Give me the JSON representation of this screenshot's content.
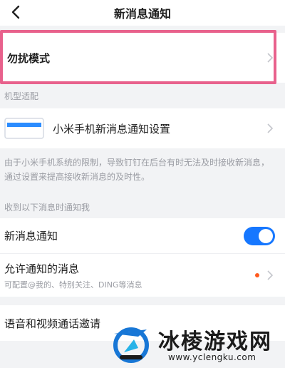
{
  "nav": {
    "title": "新消息通知",
    "back_icon": "chevron-left-icon"
  },
  "dnd": {
    "label": "勿扰模式"
  },
  "model_section": {
    "label": "机型适配"
  },
  "xiaomi": {
    "label": "小米手机新消息通知设置",
    "icon": "phone-banner-icon",
    "description": "由于小米手机系统的限制，导致钉钉在后台有时无法及时接收新消息，通过设置来提高接收新消息的及时性。"
  },
  "receive_section": {
    "label": "收到以下消息时通知我"
  },
  "new_message": {
    "label": "新消息通知",
    "enabled": true
  },
  "allowed": {
    "label": "允许通知的消息",
    "sublabel": "可配置@我的、特别关注、DING等消息"
  },
  "voice_video": {
    "label": "语音和视频通话邀请"
  },
  "watermark": {
    "name": "冰棱游戏网",
    "url": "www.yclengku.com"
  },
  "colors": {
    "accent": "#1677ff",
    "highlight": "#e8618c",
    "dot": "#ff5a1f"
  }
}
